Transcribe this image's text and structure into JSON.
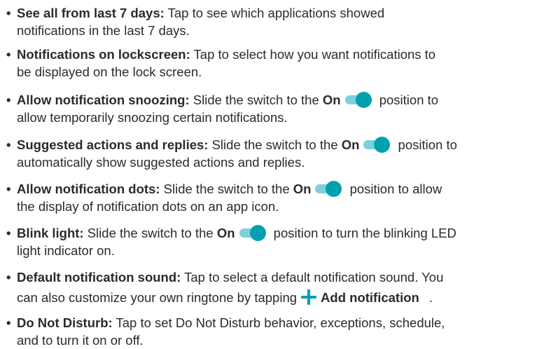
{
  "items": [
    {
      "term": "See all from last 7 days:",
      "line1": " Tap to see which applications showed",
      "line2": "notifications in the last 7 days."
    },
    {
      "term": "Notifications on lockscreen:",
      "line1": " Tap to select how you want notifications to",
      "line2": "be displayed on the lock screen."
    },
    {
      "term": "Allow notification snoozing:",
      "pre": " Slide the switch to the ",
      "on": "On",
      "post": " position to",
      "line2": "allow temporarily snoozing certain notifications."
    },
    {
      "term": "Suggested actions and replies:",
      "pre": " Slide the switch to the ",
      "on": "On",
      "post": " position to",
      "line2": "automatically show suggested actions and replies."
    },
    {
      "term": "Allow notification dots:",
      "pre": " Slide the switch to the ",
      "on": "On",
      "post": " position to allow",
      "line2": "the display of notification dots on an app icon."
    },
    {
      "term": "Blink light:",
      "pre": " Slide the switch to the ",
      "on": "On",
      "post": " position to turn the blinking LED",
      "line2": "light indicator on."
    },
    {
      "term": "Default notification sound:",
      "line1": " Tap to select a default notification sound. You",
      "line2_pre": "can also customize your own ringtone by tapping",
      "add_label": "Add notification",
      "line2_post": "."
    },
    {
      "term": "Do Not Disturb:",
      "line1": " Tap to set Do Not Disturb behavior, exceptions, schedule,",
      "line2": "and to turn it on or off."
    }
  ],
  "bullet": "•",
  "icons": {
    "toggle": "toggle-on-icon",
    "add": "plus-icon"
  },
  "colors": {
    "accent": "#00a0b0",
    "track": "#7fd0dd",
    "text": "#2b2b2b"
  }
}
